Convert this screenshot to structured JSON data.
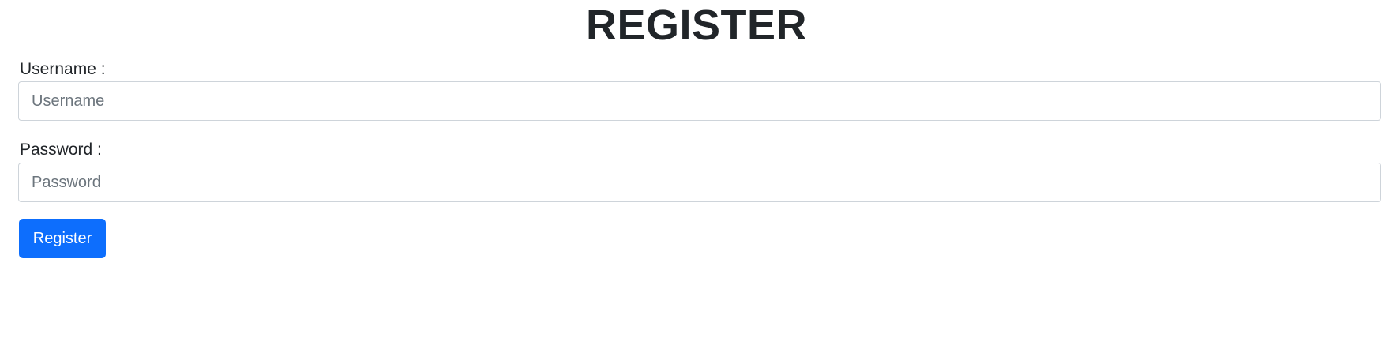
{
  "form": {
    "title": "REGISTER",
    "username": {
      "label": "Username :",
      "placeholder": "Username",
      "value": ""
    },
    "password": {
      "label": "Password :",
      "placeholder": "Password",
      "value": ""
    },
    "submit_label": "Register"
  },
  "colors": {
    "primary": "#0d6efd",
    "text": "#212529",
    "placeholder": "#6c757d",
    "border": "#ced4da",
    "background": "#ffffff"
  }
}
